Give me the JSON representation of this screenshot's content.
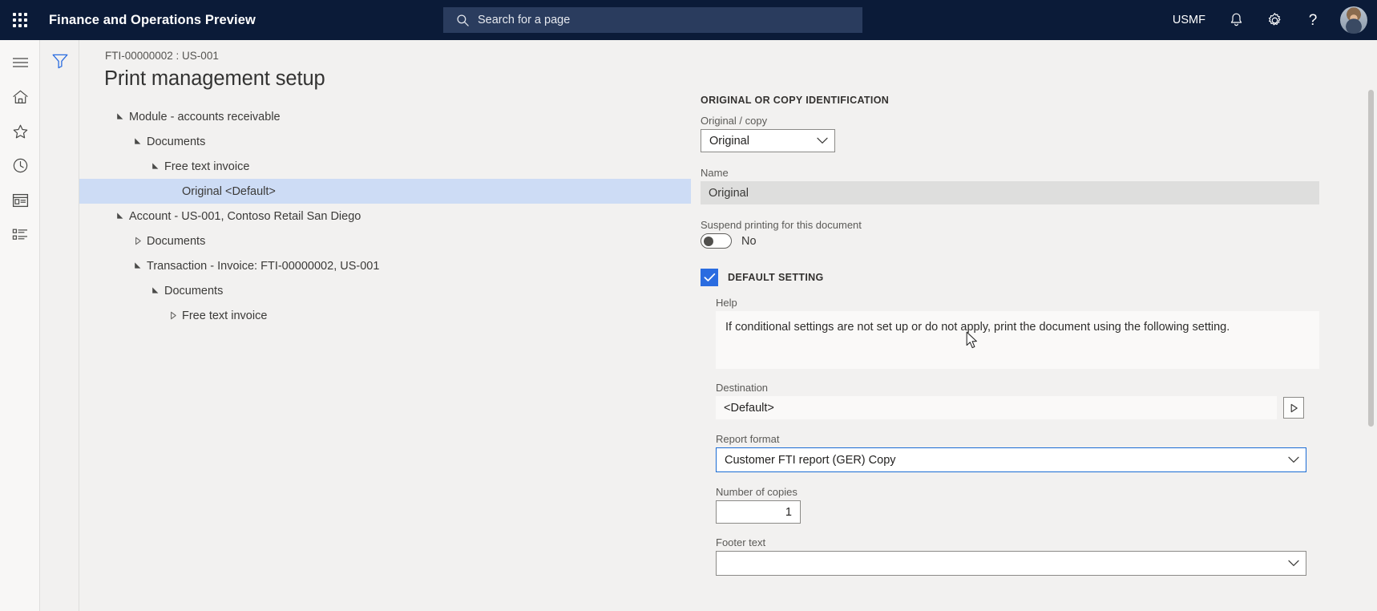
{
  "topbar": {
    "waffle_icon": "app-launcher-icon",
    "app_title": "Finance and Operations Preview",
    "search": {
      "icon": "search-icon",
      "placeholder": "Search for a page",
      "value": ""
    },
    "company": "USMF",
    "notifications_icon": "bell-icon",
    "settings_icon": "gear-icon",
    "help_icon": "question-mark-icon",
    "avatar_icon": "user-avatar"
  },
  "rail": {
    "items": [
      {
        "name": "hamburger-menu-icon",
        "label": "Expand the navigation pane"
      },
      {
        "name": "home-icon",
        "label": "Home"
      },
      {
        "name": "star-icon",
        "label": "Favorites"
      },
      {
        "name": "clock-icon",
        "label": "Recent"
      },
      {
        "name": "workspace-icon",
        "label": "Workspaces"
      },
      {
        "name": "modules-list-icon",
        "label": "Modules"
      }
    ]
  },
  "filter_pane": {
    "icon": "filter-funnel-icon",
    "color": "#2a6ce0"
  },
  "page": {
    "breadcrumb": "FTI-00000002 : US-001",
    "title": "Print management setup"
  },
  "tree": {
    "nodes": [
      {
        "label": "Module - accounts receivable",
        "depth": 0,
        "state": "expanded",
        "selected": false
      },
      {
        "label": "Documents",
        "depth": 1,
        "state": "expanded",
        "selected": false
      },
      {
        "label": "Free text invoice",
        "depth": 2,
        "state": "expanded",
        "selected": false
      },
      {
        "label": "Original <Default>",
        "depth": 3,
        "state": "leaf",
        "selected": true
      },
      {
        "label": "Account - US-001, Contoso Retail San Diego",
        "depth": 0,
        "state": "expanded",
        "selected": false
      },
      {
        "label": "Documents",
        "depth": 1,
        "state": "collapsed",
        "selected": false
      },
      {
        "label": "Transaction - Invoice: FTI-00000002, US-001",
        "depth": 1,
        "state": "expanded",
        "selected": false
      },
      {
        "label": "Documents",
        "depth": 2,
        "state": "expanded",
        "selected": false
      },
      {
        "label": "Free text invoice",
        "depth": 3,
        "state": "collapsed",
        "selected": false
      }
    ],
    "selected_highlight_color": "#cddcf5"
  },
  "form": {
    "identification_section": {
      "header": "ORIGINAL OR COPY IDENTIFICATION",
      "original_copy": {
        "label": "Original / copy",
        "value": "Original"
      },
      "name": {
        "label": "Name",
        "value": "Original",
        "readonly": true
      },
      "suspend": {
        "label": "Suspend printing for this document",
        "value": "No",
        "on": false
      }
    },
    "default_setting_section": {
      "checkbox_label": "DEFAULT SETTING",
      "checked": true,
      "checkbox_color": "#2a6ce0",
      "help": {
        "label": "Help",
        "text": "If conditional settings are not set up or do not apply, print the document using the following setting."
      },
      "destination": {
        "label": "Destination",
        "value": "<Default>",
        "button_icon": "play-triangle-icon"
      },
      "report_format": {
        "label": "Report format",
        "value": "Customer FTI report (GER) Copy",
        "focused": true,
        "focus_color": "#1a6cd4"
      },
      "number_of_copies": {
        "label": "Number of copies",
        "value": "1"
      },
      "footer_text": {
        "label": "Footer text",
        "value": ""
      }
    }
  }
}
